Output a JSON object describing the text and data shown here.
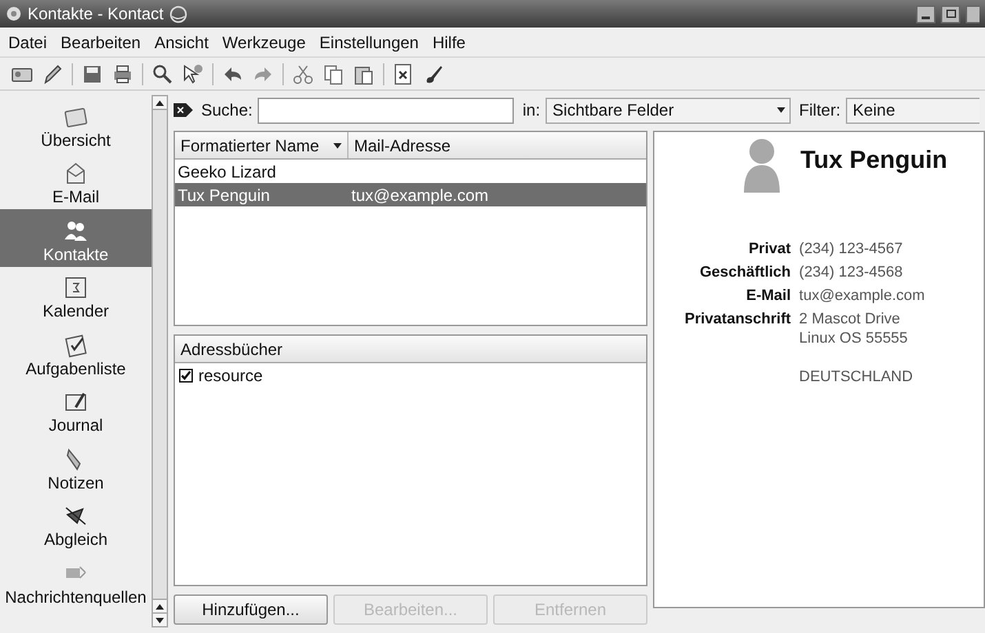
{
  "window": {
    "title": "Kontakte - Kontact"
  },
  "menu": [
    "Datei",
    "Bearbeiten",
    "Ansicht",
    "Werkzeuge",
    "Einstellungen",
    "Hilfe"
  ],
  "sidebar": {
    "items": [
      {
        "label": "Übersicht",
        "selected": false
      },
      {
        "label": "E-Mail",
        "selected": false
      },
      {
        "label": "Kontakte",
        "selected": true
      },
      {
        "label": "Kalender",
        "selected": false
      },
      {
        "label": "Aufgabenliste",
        "selected": false
      },
      {
        "label": "Journal",
        "selected": false
      },
      {
        "label": "Notizen",
        "selected": false
      },
      {
        "label": "Abgleich",
        "selected": false
      },
      {
        "label": "Nachrichtenquellen",
        "selected": false
      }
    ]
  },
  "search": {
    "label": "Suche:",
    "scope_label": "in:",
    "scope": "Sichtbare Felder",
    "filter_label": "Filter:",
    "filter": "Keine"
  },
  "contacts_table": {
    "columns": [
      {
        "label": "Formatierter Name",
        "sorted": true
      },
      {
        "label": "Mail-Adresse",
        "sorted": false
      }
    ],
    "rows": [
      {
        "cells": [
          "Geeko Lizard",
          null
        ],
        "selected": false
      },
      {
        "cells": [
          "Tux Penguin",
          "tux@example.com"
        ],
        "selected": true
      }
    ]
  },
  "address_books": {
    "header": "Adressbücher",
    "items": [
      {
        "label": "resource",
        "checked": true
      }
    ]
  },
  "buttons": [
    {
      "label": "Hinzufügen...",
      "disabled": false
    },
    {
      "label": "Bearbeiten...",
      "disabled": true
    },
    {
      "label": "Entfernen",
      "disabled": true
    }
  ],
  "detail": {
    "name": "Tux Penguin",
    "fields": [
      {
        "label": "Privat",
        "lines": [
          "(234) 123-4567"
        ]
      },
      {
        "label": "Geschäftlich",
        "lines": [
          "(234) 123-4568"
        ]
      },
      {
        "label": "E-Mail",
        "lines": [
          "tux@example.com"
        ]
      },
      {
        "label": "Privatanschrift",
        "lines": [
          "2 Mascot Drive",
          "Linux OS 55555"
        ],
        "country": "DEUTSCHLAND"
      }
    ]
  }
}
